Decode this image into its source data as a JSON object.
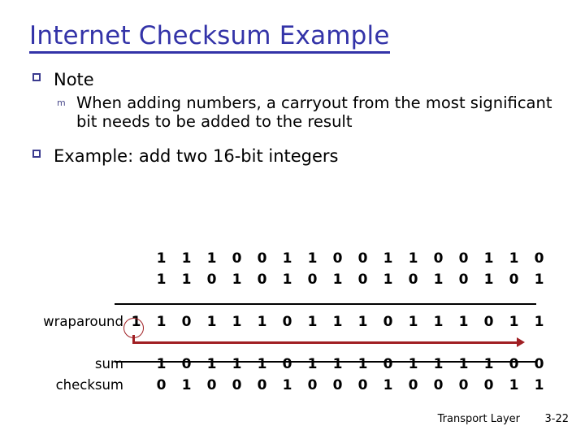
{
  "slide": {
    "title": "Internet Checksum Example",
    "title_color": "#3333a8",
    "bullets": [
      {
        "marker": "hollow-square-bullet",
        "text": "Note",
        "sub": [
          {
            "marker": "m-bullet",
            "text": "When adding numbers, a carryout from the most significant bit needs to be added to the result"
          }
        ]
      },
      {
        "marker": "hollow-square-bullet",
        "text": "Example: add two 16-bit integers",
        "sub": []
      }
    ]
  },
  "calculation": {
    "annotation_color": "#a01f23",
    "operand1_label": "",
    "operand1": [
      "1",
      "1",
      "1",
      "0",
      "0",
      "1",
      "1",
      "0",
      "0",
      "1",
      "1",
      "0",
      "0",
      "1",
      "1",
      "0"
    ],
    "operand2_label": "",
    "operand2": [
      "1",
      "1",
      "0",
      "1",
      "0",
      "1",
      "0",
      "1",
      "0",
      "1",
      "0",
      "1",
      "0",
      "1",
      "0",
      "1"
    ],
    "wraparound_label": "wraparound",
    "wraparound_carry": "1",
    "wraparound": [
      "1",
      "0",
      "1",
      "1",
      "1",
      "0",
      "1",
      "1",
      "1",
      "0",
      "1",
      "1",
      "1",
      "0",
      "1",
      "1"
    ],
    "sum_label": "sum",
    "sum": [
      "1",
      "0",
      "1",
      "1",
      "1",
      "0",
      "1",
      "1",
      "1",
      "0",
      "1",
      "1",
      "1",
      "1",
      "0",
      "0"
    ],
    "checksum_label": "checksum",
    "checksum": [
      "0",
      "1",
      "0",
      "0",
      "0",
      "1",
      "0",
      "0",
      "0",
      "1",
      "0",
      "0",
      "0",
      "0",
      "1",
      "1"
    ]
  },
  "footer": {
    "label": "Transport Layer",
    "page": "3-22"
  }
}
